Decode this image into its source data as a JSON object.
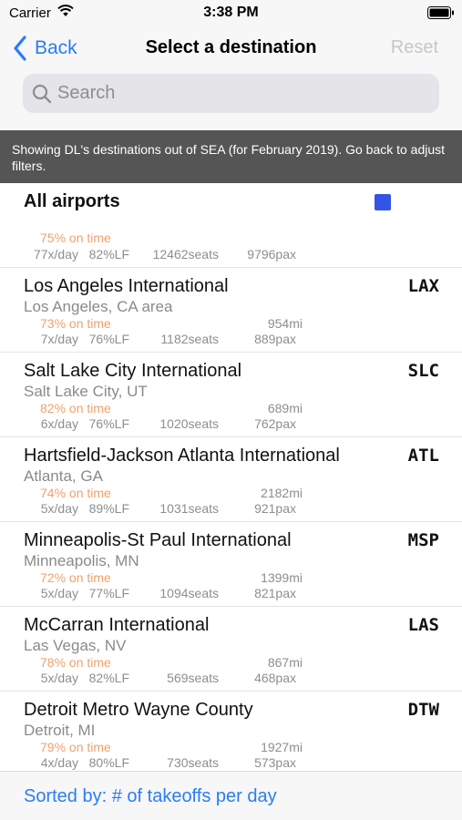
{
  "status_bar": {
    "carrier": "Carrier",
    "time": "3:38 PM"
  },
  "nav": {
    "back_label": "Back",
    "title": "Select a destination",
    "reset_label": "Reset"
  },
  "search": {
    "placeholder": "Search",
    "value": ""
  },
  "banner": {
    "text": "Showing DL's destinations out of SEA (for February 2019).  Go back to adjust filters."
  },
  "all_airports": {
    "name": "All airports",
    "selected": true,
    "on_time": "75% on time",
    "freq": "77x/day",
    "lf": "82%LF",
    "seats": "12462seats",
    "pax": "9796pax"
  },
  "destinations": [
    {
      "name": "Los Angeles International",
      "code": "LAX",
      "area": "Los Angeles, CA area",
      "on_time": "73% on time",
      "miles": "954mi",
      "freq": "7x/day",
      "lf": "76%LF",
      "seats": "1182seats",
      "pax": "889pax"
    },
    {
      "name": "Salt Lake City International",
      "code": "SLC",
      "area": "Salt Lake City, UT",
      "on_time": "82% on time",
      "miles": "689mi",
      "freq": "6x/day",
      "lf": "76%LF",
      "seats": "1020seats",
      "pax": "762pax"
    },
    {
      "name": "Hartsfield-Jackson Atlanta International",
      "code": "ATL",
      "area": "Atlanta, GA",
      "on_time": "74% on time",
      "miles": "2182mi",
      "freq": "5x/day",
      "lf": "89%LF",
      "seats": "1031seats",
      "pax": "921pax"
    },
    {
      "name": "Minneapolis-St Paul International",
      "code": "MSP",
      "area": "Minneapolis, MN",
      "on_time": "72% on time",
      "miles": "1399mi",
      "freq": "5x/day",
      "lf": "77%LF",
      "seats": "1094seats",
      "pax": "821pax"
    },
    {
      "name": "McCarran International",
      "code": "LAS",
      "area": "Las Vegas, NV",
      "on_time": "78% on time",
      "miles": "867mi",
      "freq": "5x/day",
      "lf": "82%LF",
      "seats": "569seats",
      "pax": "468pax"
    },
    {
      "name": "Detroit Metro Wayne County",
      "code": "DTW",
      "area": "Detroit, MI",
      "on_time": "79% on time",
      "miles": "1927mi",
      "freq": "4x/day",
      "lf": "80%LF",
      "seats": "730seats",
      "pax": "573pax"
    }
  ],
  "footer": {
    "sorted_by": "Sorted by: # of takeoffs per day"
  },
  "colors": {
    "accent": "#2a7cf6",
    "on_time": "#f2a06a",
    "banner_bg": "#555555",
    "selected_square": "#3355e6"
  }
}
